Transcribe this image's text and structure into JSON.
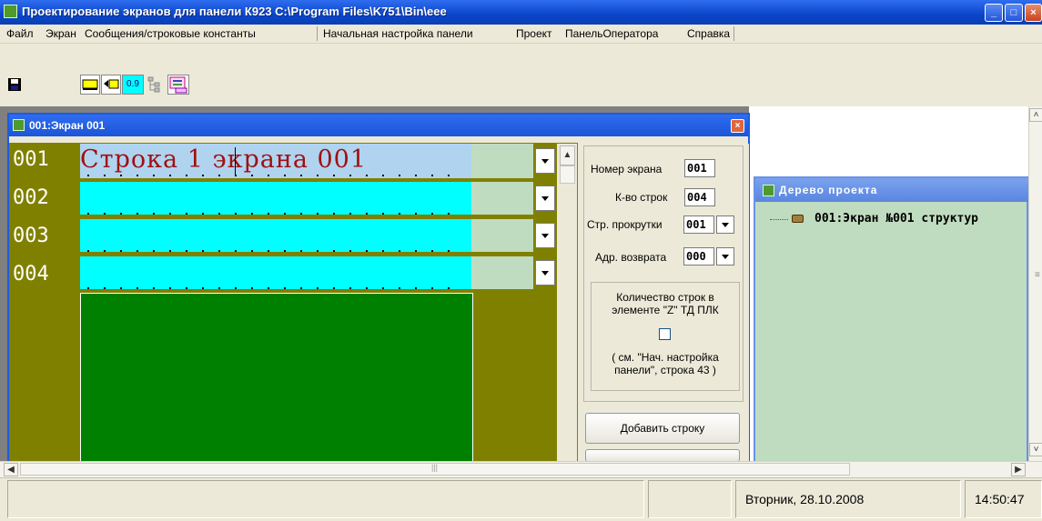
{
  "window": {
    "title": "Проектирование экранов для панели К923  C:\\Program Files\\K751\\Bin\\eee",
    "minimize": "_",
    "maximize": "□",
    "close": "×"
  },
  "menu": {
    "items": [
      "Файл",
      "Экран",
      "Сообщения/строковые константы",
      "Начальная настройка панели",
      "Проект",
      "ПанельОператора",
      "Справка"
    ]
  },
  "toolbar": {
    "icons": [
      "save-icon",
      "add-line-icon",
      "insert-line-icon",
      "number-format-icon",
      "tree-icon",
      "screen-list-icon"
    ],
    "number_label": "0.9"
  },
  "screen_window": {
    "title": "001:Экран 001",
    "close": "×",
    "rows": [
      {
        "number": "001",
        "text": "Строка 1  экрана 001"
      },
      {
        "number": "002",
        "text": ""
      },
      {
        "number": "003",
        "text": ""
      },
      {
        "number": "004",
        "text": ""
      }
    ],
    "panel": {
      "screen_number_label": "Номер экрана",
      "screen_number_value": "001",
      "rows_count_label": "К-во строк",
      "rows_count_value": "004",
      "scroll_rows_label": "Стр. прокрутки",
      "scroll_rows_value": "001",
      "return_addr_label": "Адр. возврата",
      "return_addr_value": "000",
      "group_text_1": "Количество строк в",
      "group_text_2": "элементе \"Z\" ТД ПЛК",
      "group_text_3": "( см. \"Нач. настройка",
      "group_text_4": "панели\", строка 43 )",
      "checkbox_checked": false,
      "add_row_button": "Добавить строку"
    }
  },
  "tree_window": {
    "title": "Дерево проекта",
    "item": "001:Экран №001 структур"
  },
  "statusbar": {
    "date": "Вторник, 28.10.2008",
    "time": "14:50:47"
  },
  "colors": {
    "row_field": "#00ffff",
    "editor_bg": "#808000",
    "text_area": "#008000",
    "tree_bg": "#c0dcc0",
    "title_blue": "#0a45c8"
  }
}
